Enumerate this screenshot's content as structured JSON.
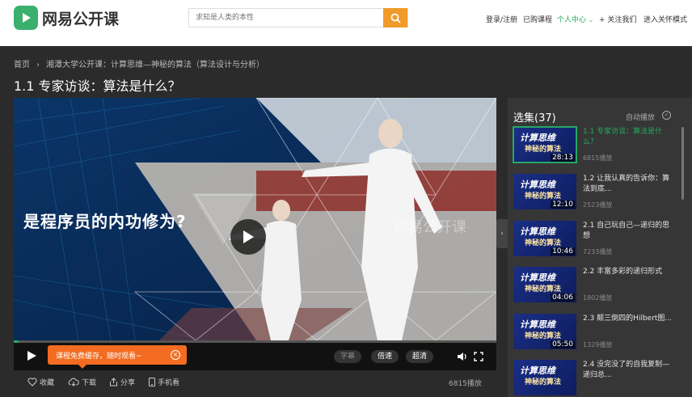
{
  "header": {
    "logo_text": "网易公开课",
    "search_placeholder": "求知是人类的本性",
    "nav": {
      "login": "登录/注册",
      "purchased": "已购课程",
      "personal": "个人中心",
      "follow": "关注我们",
      "care_mode": "进入关怀模式"
    }
  },
  "breadcrumb": {
    "home": "首页",
    "course": "湘潭大学公开课：计算思维—神秘的算法（算法设计与分析）"
  },
  "page_title": "1.1 专家访谈：算法是什么？",
  "player": {
    "overlay_text": "是程序员的内功修为?",
    "watermark": "网易公开课",
    "progress": 0.002,
    "toast": "课程免费缓存，随时观看~",
    "subtitle_label": "字幕",
    "speed_label": "倍速",
    "quality_label": "超清"
  },
  "actions": {
    "favorite": "收藏",
    "download": "下载",
    "share": "分享",
    "mobile": "手机看",
    "plays": "6815播放"
  },
  "playlist": {
    "title": "选集(37)",
    "autoplay": "自动播放",
    "thumb_line1": "计算思维",
    "thumb_line2": "神秘的算法",
    "items": [
      {
        "title": "1.1 专家访谈：算法是什么？",
        "duration": "28:13",
        "plays": "6815播放",
        "active": true
      },
      {
        "title": "1.2 让我认真的告诉你：算法到底...",
        "duration": "12:10",
        "plays": "2523播放",
        "active": false
      },
      {
        "title": "2.1 自己玩自己—递归的思想",
        "duration": "10:46",
        "plays": "7233播放",
        "active": false
      },
      {
        "title": "2.2 丰富多彩的递归形式",
        "duration": "04:06",
        "plays": "1802播放",
        "active": false
      },
      {
        "title": "2.3 颠三倒四的Hilbert图...",
        "duration": "05:50",
        "plays": "1329播放",
        "active": false
      },
      {
        "title": "2.4 没完没了的自我复制—递归总...",
        "duration": "",
        "plays": "",
        "active": false
      }
    ]
  },
  "colors": {
    "accent": "#26a862",
    "search_button": "#f09a2a",
    "toast": "#f36c21"
  }
}
